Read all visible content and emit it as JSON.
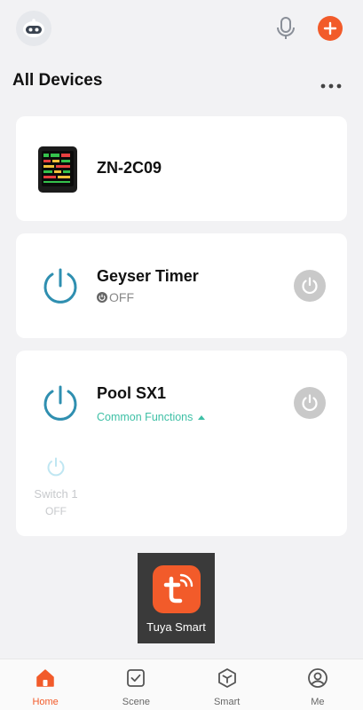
{
  "header": {
    "avatar_icon": "robot-avatar-icon",
    "mic_icon": "microphone-icon",
    "add_icon": "plus-icon",
    "title": "All Devices",
    "more_icon": "more-dots-icon"
  },
  "devices": [
    {
      "name": "ZN-2C09",
      "icon": "air-quality-monitor-image"
    },
    {
      "name": "Geyser Timer",
      "status": "OFF",
      "icon": "power-ring-icon"
    },
    {
      "name": "Pool SX1",
      "common_functions": "Common Functions",
      "icon": "power-ring-icon",
      "switches": [
        {
          "label": "Switch 1",
          "state": "OFF"
        }
      ]
    }
  ],
  "overlay": {
    "label": "Tuya Smart",
    "icon": "tuya-logo"
  },
  "tabs": [
    {
      "label": "Home",
      "icon": "home-icon",
      "active": true
    },
    {
      "label": "Scene",
      "icon": "scene-checkbox-icon",
      "active": false
    },
    {
      "label": "Smart",
      "icon": "smart-hexagon-icon",
      "active": false
    },
    {
      "label": "Me",
      "icon": "profile-icon",
      "active": false
    }
  ],
  "colors": {
    "accent": "#f25b2a",
    "teal": "#3fc0a6",
    "ring": "#2f8fb0"
  }
}
